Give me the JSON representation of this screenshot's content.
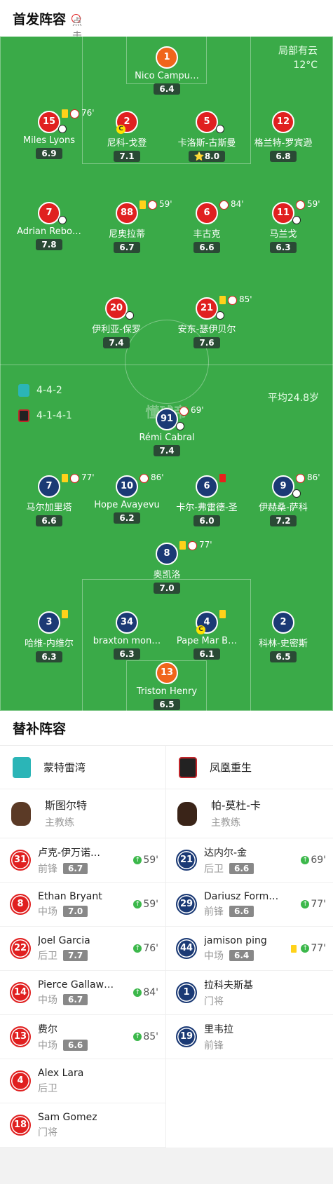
{
  "header": {
    "title": "首发阵容",
    "subtitle": "点击球员可查看本场详细数据"
  },
  "weather": {
    "condition": "局部有云",
    "temp": "12°C"
  },
  "home": {
    "formation": "4-4-2",
    "avg_age": "平均24.8岁",
    "color": "#e02020"
  },
  "away": {
    "formation": "4-1-4-1",
    "color": "#1b3a75"
  },
  "watermark": "懂球帝",
  "home_players": [
    {
      "num": "1",
      "name": "Nico Campu…",
      "rating": "6.4",
      "gk": true
    },
    {
      "num": "15",
      "name": "Miles Lyons",
      "rating": "6.9",
      "sub": "76'",
      "yellow": true,
      "subout": true
    },
    {
      "num": "2",
      "name": "尼科-戈登",
      "rating": "7.1",
      "captain": true
    },
    {
      "num": "5",
      "name": "卡洛斯-古斯曼",
      "rating": "8.0",
      "goal": true,
      "star": true
    },
    {
      "num": "12",
      "name": "格兰特-罗宾逊",
      "rating": "6.8"
    },
    {
      "num": "7",
      "name": "Adrian Rebo…",
      "rating": "7.8",
      "goal": true
    },
    {
      "num": "88",
      "name": "尼奥拉蒂",
      "rating": "6.7",
      "sub": "59'",
      "yellow": true
    },
    {
      "num": "6",
      "name": "丰古克",
      "rating": "6.6",
      "sub": "84'"
    },
    {
      "num": "11",
      "name": "马兰戈",
      "rating": "6.3",
      "sub": "59'",
      "subout": true
    },
    {
      "num": "20",
      "name": "伊利亚-保罗",
      "rating": "7.4",
      "subout": true
    },
    {
      "num": "21",
      "name": "安东-瑟伊贝尔",
      "rating": "7.6",
      "sub": "85'",
      "yellow": true,
      "goal": true
    }
  ],
  "away_players": [
    {
      "num": "91",
      "name": "Rémi Cabral",
      "rating": "7.4",
      "sub": "69'",
      "goal": true
    },
    {
      "num": "7",
      "name": "马尔加里塔",
      "rating": "6.6",
      "sub": "77'",
      "yellow": true
    },
    {
      "num": "10",
      "name": "Hope Avayevu",
      "rating": "6.2",
      "sub": "86'"
    },
    {
      "num": "6",
      "name": "卡尔-弗雷德-圣",
      "rating": "6.0",
      "red": true
    },
    {
      "num": "9",
      "name": "伊赫桑-萨科",
      "rating": "7.2",
      "sub": "86'",
      "subout": true
    },
    {
      "num": "8",
      "name": "奥凯洛",
      "rating": "7.0",
      "sub": "77'",
      "yellow": true
    },
    {
      "num": "3",
      "name": "哈维-内维尔",
      "rating": "6.3",
      "yellow": true
    },
    {
      "num": "34",
      "name": "braxton mon…",
      "rating": "6.3"
    },
    {
      "num": "4",
      "name": "Pape Mar B…",
      "rating": "6.1",
      "yellow": true,
      "captain": true
    },
    {
      "num": "2",
      "name": "科林-史密斯",
      "rating": "6.5"
    },
    {
      "num": "13",
      "name": "Triston Henry",
      "rating": "6.5",
      "gk": true
    }
  ],
  "subs": {
    "title": "替补阵容",
    "home_team": "蒙特雷湾",
    "away_team": "凤凰重生",
    "home_coach": {
      "name": "斯图尔特",
      "role": "主教练"
    },
    "away_coach": {
      "name": "帕-莫杜-卡",
      "role": "主教练"
    },
    "home_list": [
      {
        "num": "31",
        "name": "卢克-伊万诺…",
        "pos": "前锋",
        "rating": "6.7",
        "in": "59'"
      },
      {
        "num": "8",
        "name": "Ethan Bryant",
        "pos": "中场",
        "rating": "7.0",
        "in": "59'"
      },
      {
        "num": "22",
        "name": "Joel Garcia",
        "pos": "后卫",
        "rating": "7.7",
        "in": "76'"
      },
      {
        "num": "14",
        "name": "Pierce Gallaw…",
        "pos": "中场",
        "rating": "6.7",
        "in": "84'"
      },
      {
        "num": "13",
        "name": "费尔",
        "pos": "中场",
        "rating": "6.6",
        "in": "85'"
      },
      {
        "num": "4",
        "name": "Alex Lara",
        "pos": "后卫"
      },
      {
        "num": "18",
        "name": "Sam Gomez",
        "pos": "门将"
      }
    ],
    "away_list": [
      {
        "num": "21",
        "name": "达内尔-金",
        "pos": "后卫",
        "rating": "6.6",
        "in": "69'"
      },
      {
        "num": "29",
        "name": "Dariusz Form…",
        "pos": "前锋",
        "rating": "6.6",
        "in": "77'"
      },
      {
        "num": "44",
        "name": "jamison ping",
        "pos": "中场",
        "rating": "6.4",
        "in": "77'",
        "yellow": true
      },
      {
        "num": "1",
        "name": "拉科夫斯基",
        "pos": "门将"
      },
      {
        "num": "19",
        "name": "里韦拉",
        "pos": "前锋"
      }
    ]
  }
}
